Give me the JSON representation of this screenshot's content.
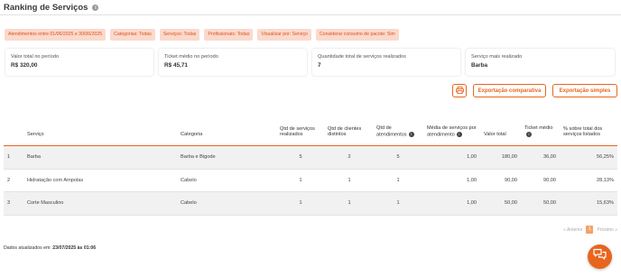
{
  "header": {
    "title": "Ranking de Serviços",
    "info_icon": "i"
  },
  "filters": [
    "Atendimentos entre 01/06/2025 e 30/06/2025",
    "Categorias: Todas",
    "Serviços: Todas",
    "Profissionais: Todas",
    "Visualizar por: Serviço",
    "Considerar consumo de pacote: Sim"
  ],
  "summary_cards": [
    {
      "label": "Valor total no período",
      "value": "R$ 320,00"
    },
    {
      "label": "Ticket médio no período",
      "value": "R$ 45,71"
    },
    {
      "label": "Quantidade total de serviços realizados",
      "value": "7"
    },
    {
      "label": "Serviço mais realizado",
      "value": "Barba"
    }
  ],
  "actions": {
    "print_icon": "printer-icon",
    "compare_label": "Exportação comparativa",
    "simple_label": "Exportação simples"
  },
  "table": {
    "columns": {
      "servico": "Serviço",
      "categoria": "Categoria",
      "qtd_servicos": "Qtd de serviços realizados",
      "qtd_clientes": "Qtd de clientes distintos",
      "qtd_atendimentos": "Qtd de atendimentos",
      "media": "Média de serviços por atendimento",
      "valor_total": "Valor total",
      "ticket": "Ticket médio",
      "percent": "% sobre total dos serviços listados"
    },
    "rows": [
      {
        "rank": "1",
        "servico": "Barba",
        "categoria": "Barba e Bigode",
        "qtd_servicos": "5",
        "qtd_clientes": "2",
        "qtd_atendimentos": "5",
        "media": "1,00",
        "valor_total": "180,00",
        "ticket": "36,00",
        "percent": "56,25%"
      },
      {
        "rank": "2",
        "servico": "Hidratação com Ampolas",
        "categoria": "Cabelo",
        "qtd_servicos": "1",
        "qtd_clientes": "1",
        "qtd_atendimentos": "1",
        "media": "1,00",
        "valor_total": "90,00",
        "ticket": "90,00",
        "percent": "28,13%"
      },
      {
        "rank": "3",
        "servico": "Corte Masculino",
        "categoria": "Cabelo",
        "qtd_servicos": "1",
        "qtd_clientes": "1",
        "qtd_atendimentos": "1",
        "media": "1,00",
        "valor_total": "50,00",
        "ticket": "50,00",
        "percent": "15,63%"
      }
    ]
  },
  "pagination": {
    "prev": "« Anterior",
    "current": "1",
    "next": "Próximo »"
  },
  "footer": {
    "label": "Dados atualizados em:",
    "value": "23/07/2025 às 01:06"
  },
  "chat": {
    "icon": "chat-icon"
  }
}
